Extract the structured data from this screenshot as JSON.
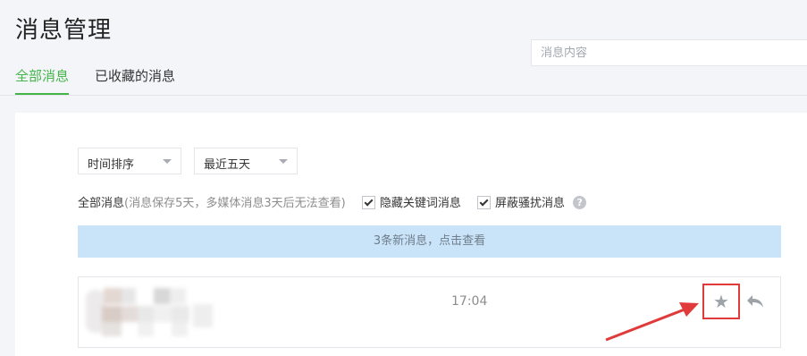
{
  "page": {
    "title": "消息管理"
  },
  "search": {
    "placeholder": "消息内容",
    "value": ""
  },
  "tabs": [
    {
      "label": "全部消息",
      "active": true
    },
    {
      "label": "已收藏的消息",
      "active": false
    }
  ],
  "filters": {
    "sort_select": "时间排序",
    "range_select": "最近五天"
  },
  "options": {
    "all_label": "全部消息",
    "note": "(消息保存5天，多媒体消息3天后无法查看)",
    "hide_keyword_label": "隐藏关键词消息",
    "hide_keyword_checked": true,
    "block_spam_label": "屏蔽骚扰消息",
    "block_spam_checked": true,
    "help_icon": "question-circle-icon"
  },
  "banner": {
    "text": "3条新消息，点击查看"
  },
  "messages": [
    {
      "time": "17:04",
      "starred": false,
      "icons": [
        "star-icon",
        "reply-icon"
      ]
    }
  ],
  "colors": {
    "accent_green": "#44b549",
    "banner_bg": "#c9e3f9",
    "annotation_red": "#e03a3a"
  }
}
